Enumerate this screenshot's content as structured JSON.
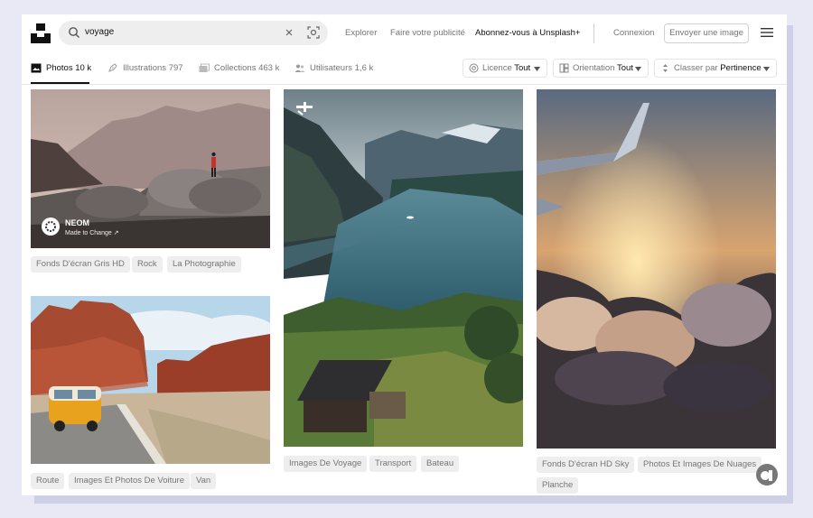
{
  "header": {
    "search_value": "voyage",
    "nav": {
      "explore": "Explorer",
      "advertise": "Faire votre publicité",
      "subscribe": "Abonnez-vous à Unsplash+",
      "login": "Connexion",
      "submit": "Envoyer une image"
    }
  },
  "tabs": [
    {
      "label": "Photos",
      "count": "10 k"
    },
    {
      "label": "Illustrations",
      "count": "797"
    },
    {
      "label": "Collections",
      "count": "463 k"
    },
    {
      "label": "Utilisateurs",
      "count": "1,6 k"
    }
  ],
  "filters": [
    {
      "label": "Licence",
      "value": "Tout"
    },
    {
      "label": "Orientation",
      "value": "Tout"
    },
    {
      "label": "Classer par",
      "value": "Pertinence"
    }
  ],
  "sponsor": {
    "name": "NEOM",
    "subtitle": "Made to Change ↗"
  },
  "columns": {
    "col1_top_tags": [
      "Fonds D'écran Gris HD",
      "Rock",
      "La Photographie"
    ],
    "col1_bottom_tags": [
      "Route",
      "Images Et Photos De Voiture",
      "Van"
    ],
    "col2_tags": [
      "Images De Voyage",
      "Transport",
      "Bateau"
    ],
    "col3_tags": [
      "Fonds D'écran HD Sky",
      "Photos Et Images De Nuages",
      "Planche"
    ]
  },
  "colors": {
    "accent": "#111111",
    "muted_text": "#767676",
    "tag_bg": "#eeeeee",
    "border": "#e5e5e5"
  }
}
